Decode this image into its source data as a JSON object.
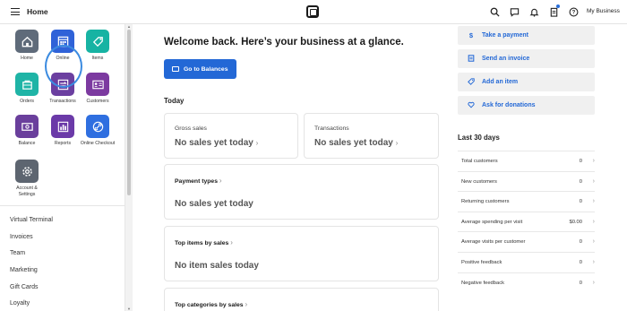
{
  "topbar": {
    "title": "Home",
    "business": "My Business",
    "icons": [
      "menu-icon",
      "square-logo",
      "search-icon",
      "messages-icon",
      "bell-icon",
      "clipboard-icon",
      "help-icon"
    ]
  },
  "sidebar": {
    "apps": [
      {
        "label": "Home",
        "color": "#5f6b7a"
      },
      {
        "label": "Online",
        "color": "#2f62d8"
      },
      {
        "label": "Items",
        "color": "#17b3a3"
      },
      {
        "label": "Orders",
        "color": "#1fb4a6"
      },
      {
        "label": "Transactions",
        "color": "#6b3fa0"
      },
      {
        "label": "Customers",
        "color": "#7c3aa0"
      },
      {
        "label": "Balance",
        "color": "#6a3f9c"
      },
      {
        "label": "Reports",
        "color": "#6b3aa8"
      },
      {
        "label": "Online Checkout",
        "color": "#2f6fe0"
      },
      {
        "label": "Account & Settings",
        "color": "#5d6570"
      }
    ],
    "links": [
      "Virtual Terminal",
      "Invoices",
      "Team",
      "Marketing",
      "Gift Cards",
      "Loyalty"
    ]
  },
  "main": {
    "welcome": "Welcome back. Here’s your business at a glance.",
    "balances_button": "Go to Balances",
    "today_heading": "Today",
    "gross_sales_label": "Gross sales",
    "gross_sales_value": "No sales yet today",
    "transactions_label": "Transactions",
    "transactions_value": "No sales yet today",
    "payment_types_label": "Payment types",
    "payment_types_value": "No sales yet today",
    "top_items_label": "Top items by sales",
    "top_items_value": "No item sales today",
    "top_categories_label": "Top categories by sales"
  },
  "right": {
    "actions": [
      {
        "label": "Take a payment",
        "icon": "dollar-icon"
      },
      {
        "label": "Send an invoice",
        "icon": "invoice-icon"
      },
      {
        "label": "Add an item",
        "icon": "tag-icon"
      },
      {
        "label": "Ask for donations",
        "icon": "heart-icon"
      }
    ],
    "last30_heading": "Last 30 days",
    "stats": [
      {
        "label": "Total customers",
        "value": "0"
      },
      {
        "label": "New customers",
        "value": "0"
      },
      {
        "label": "Returning customers",
        "value": "0"
      },
      {
        "label": "Average spending per visit",
        "value": "$0.00"
      },
      {
        "label": "Average visits per customer",
        "value": "0"
      },
      {
        "label": "Positive feedback",
        "value": "0"
      },
      {
        "label": "Negative feedback",
        "value": "0"
      }
    ]
  },
  "colors": {
    "accent": "#2368d6",
    "highlight_ring": "#3b8be0"
  }
}
